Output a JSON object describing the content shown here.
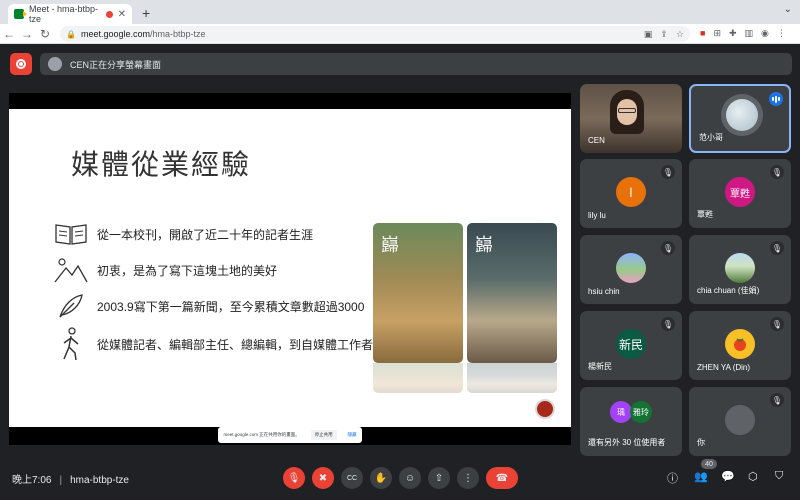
{
  "browser": {
    "tab_title": "Meet - hma-btbp-tze",
    "url_domain": "meet.google.com",
    "url_path": "/hma-btbp-tze"
  },
  "meet": {
    "presenter_banner": "CEN正在分享螢幕畫面",
    "meeting_time": "晚上7:06",
    "meeting_code": "hma-btbp-tze",
    "participant_count": "40"
  },
  "slide": {
    "title": "媒體從業經驗",
    "bullets": [
      {
        "icon": "book-icon",
        "text": "從一本校刊，開啟了近二十年的記者生涯"
      },
      {
        "icon": "mountain-icon",
        "text": "初衷，是為了寫下這塊土地的美好"
      },
      {
        "icon": "feather-icon",
        "text": "2003.9寫下第一篇新聞，至今累積文章數超過3000"
      },
      {
        "icon": "walking-person-icon",
        "text": "從媒體記者、編輯部主任、總編輯，到自媒體工作者"
      }
    ]
  },
  "share_toast": {
    "text": "meet.google.com 正在共用你的畫面。",
    "stop_label": "停止共用",
    "hide_label": "隱藏"
  },
  "participants": [
    {
      "name": "CEN",
      "avatar_text": "",
      "muted": false,
      "camera": true
    },
    {
      "name": "范小哥",
      "avatar_text": "",
      "muted": false,
      "speaking": true
    },
    {
      "name": "lily lu",
      "avatar_text": "l",
      "avatar_color": "#e8710a",
      "muted": true
    },
    {
      "name": "覃甦",
      "avatar_text": "覃甦",
      "avatar_color": "#d01884",
      "muted": true
    },
    {
      "name": "hsiu chin",
      "avatar_text": "",
      "muted": true
    },
    {
      "name": "chia chuan (佳娟)",
      "avatar_text": "",
      "muted": true
    },
    {
      "name": "楊新民",
      "avatar_text": "新民",
      "avatar_color": "#0b5a43",
      "muted": true
    },
    {
      "name": "ZHEN YA (Din)",
      "avatar_text": "",
      "muted": true
    },
    {
      "name": "還有另外 30 位使用者",
      "avatar_text": "",
      "muted": false,
      "others": [
        "瑀",
        "雅玲"
      ]
    },
    {
      "name": "你",
      "avatar_text": "",
      "muted": true
    }
  ],
  "colors": {
    "accent_red": "#ea4335",
    "active_speaker": "#8ab4f8",
    "tile_bg": "#3c4043",
    "page_bg": "#202124"
  }
}
